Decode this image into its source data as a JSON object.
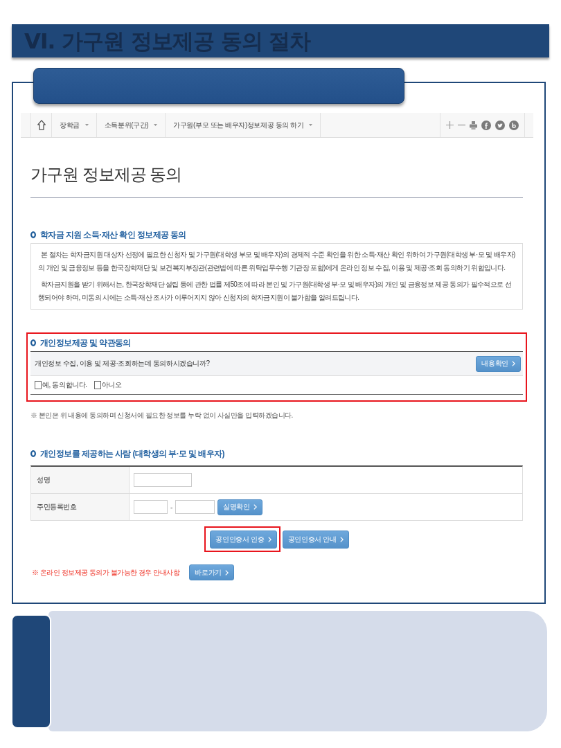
{
  "banner": {
    "title": "VI. 가구원 정보제공 동의 절차"
  },
  "breadcrumb": {
    "items": [
      {
        "label": "장학금"
      },
      {
        "label": "소득분위(구간)"
      },
      {
        "label": "가구원(부모 또는 배우자)정보제공 동의 하기"
      }
    ]
  },
  "page_title": "가구원 정보제공 동의",
  "info": {
    "heading": "학자금 지원 소득·재산 확인 정보제공 동의",
    "paragraphs": [
      "본 절차는 학자금지원 대상자 선정에 필요한 신청자 및 가구원(대학생 부모 및 배우자)의 경제적 수준 확인을 위한 소득·재산 확인 위하여 가구원(대학생 부·모 및 배우자)의 개인 및 금융정보 등을 한국장학재단 및 보건복지부장관(관련법에 따른 위탁업무수행 기관장 포함)에게 온라인 정보 수집, 이용 및 제공·조회 동의하기 위함입니다.",
      "학자금지원을 받기 위해서는, 한국장학재단 설립 등에 관한 법률 제50조에 따라 본인 및 가구원(대학생 부·모 및 배우자)의 개인 및 금융정보 제공 동의가 필수적으로 선행되어야 하며, 미동의 시에는 소득·재산 조사가 이루어지지 않아 신청자의 학자금지원이 불가함을 알려드립니다."
    ]
  },
  "consent": {
    "highlighted": true,
    "heading": "개인정보제공 및 약관동의",
    "question": "개인정보 수집, 이용 및 제공·조회하는데 동의하시겠습니까?",
    "button": "내용확인",
    "options": [
      {
        "label": "예, 동의합니다.",
        "checked": false
      },
      {
        "label": "아니오",
        "checked": false
      }
    ]
  },
  "note": "※ 본인은 위 내용에 동의하며 신청서에 필요한 정보를 누락 없이 사실만을 입력하겠습니다.",
  "provider": {
    "heading": "개인정보를 제공하는 사람 (대학생의 부·모 및 배우자)",
    "rows": [
      {
        "label": "성명",
        "kind": "text"
      },
      {
        "label": "주민등록번호",
        "kind": "id-number",
        "separator": "-",
        "button": "실명확인"
      }
    ]
  },
  "actions": [
    {
      "label": "공인인증서 인증",
      "highlighted": true
    },
    {
      "label": "공인인증서 안내",
      "highlighted": false
    }
  ],
  "help": {
    "text": "※ 온라인 정보제공 동의가 불가능한 경우 안내사항",
    "button": "바로가기"
  }
}
